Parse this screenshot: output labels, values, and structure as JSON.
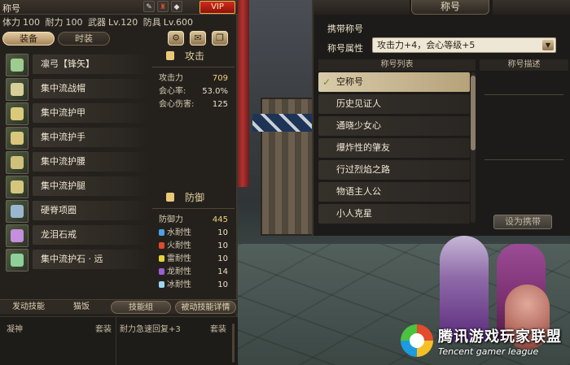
{
  "colors": {
    "vip_red": "#c2231a",
    "gold_value": "#f2d27c",
    "selected_title_bg": "#d0c09c",
    "check_green": "#6a8e2a"
  },
  "watermark": {
    "cn": "腾讯游戏玩家联盟",
    "en": "Tencent gamer league"
  },
  "left_panel": {
    "title": "称号",
    "top_icons": [
      "pen-icon",
      "character-icon",
      "gem-icon"
    ],
    "vip": "VIP",
    "stats": [
      {
        "label": "体力",
        "value": "100"
      },
      {
        "label": "耐力",
        "value": "100"
      },
      {
        "label": "武器",
        "value": "Lv.120"
      },
      {
        "label": "防具",
        "value": "Lv.600"
      }
    ],
    "tabs": [
      "装备",
      "时装"
    ],
    "active_tab": 0,
    "tool_icons": [
      "gear-icon",
      "scroll-icon",
      "book-icon"
    ],
    "equipment": [
      {
        "name": "凛弓【锋矢】",
        "icon": "bow-icon",
        "color": "#9ecb8f"
      },
      {
        "name": "集中流战帽",
        "icon": "helmet-icon",
        "color": "#d8cf98"
      },
      {
        "name": "集中流护甲",
        "icon": "armor-icon",
        "color": "#d9c979"
      },
      {
        "name": "集中流护手",
        "icon": "gloves-icon",
        "color": "#d8c77d"
      },
      {
        "name": "集中流护腰",
        "icon": "belt-icon",
        "color": "#cfc07b"
      },
      {
        "name": "集中流护腿",
        "icon": "boots-icon",
        "color": "#d4c67c"
      },
      {
        "name": "硬脊项圈",
        "icon": "necklace-icon",
        "color": "#9ab7cf"
      },
      {
        "name": "龙泪石戒",
        "icon": "ring-icon",
        "color": "#c48fdc"
      },
      {
        "name": "集中流护石 · 远",
        "icon": "charm-icon",
        "color": "#8fd09a"
      }
    ],
    "attack": {
      "heading": "攻击",
      "rows": [
        {
          "label": "攻击力",
          "value": "709",
          "highlight": true
        },
        {
          "label": "会心率:",
          "value": "53.0%"
        },
        {
          "label": "会心伤害:",
          "value": "125"
        }
      ]
    },
    "defense": {
      "heading": "防御",
      "rows": [
        {
          "label": "防御力",
          "value": "445",
          "highlight": true
        },
        {
          "label": "水耐性",
          "value": "10",
          "dot": "#4aa3e8"
        },
        {
          "label": "火耐性",
          "value": "10",
          "dot": "#e04b2c"
        },
        {
          "label": "雷耐性",
          "value": "10",
          "dot": "#e8d23c"
        },
        {
          "label": "龙耐性",
          "value": "14",
          "dot": "#9a5fd0"
        },
        {
          "label": "冰耐性",
          "value": "10",
          "dot": "#9ed6f0"
        }
      ]
    },
    "bottom_buttons": [
      "发动技能",
      "猫饭",
      "技能组",
      "被动技能详情"
    ],
    "skills": {
      "left_name": "凝神",
      "left_type": "套装",
      "right_name": "耐力急速回复+3",
      "right_type": "套装"
    }
  },
  "title_panel": {
    "header": "称号",
    "carry_label": "携带称号",
    "attr_label": "称号属性",
    "attr_value": "攻击力+4，会心等级+5",
    "list_header": "称号列表",
    "desc_header": "称号描述",
    "titles": [
      "空称号",
      "历史见证人",
      "通晓少女心",
      "爆炸性的肇友",
      "行过烈焰之路",
      "物语主人公",
      "小人克星"
    ],
    "selected_index": 0,
    "set_button": "设为携带"
  }
}
